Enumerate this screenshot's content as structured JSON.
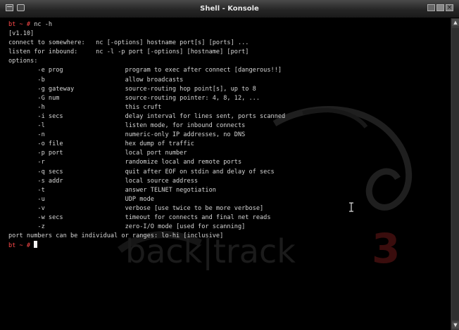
{
  "window": {
    "title": "Shell - Konsole"
  },
  "terminal": {
    "prompt": "bt ~ # ",
    "command": "nc -h",
    "lines": [
      "[v1.10]",
      "connect to somewhere:   nc [-options] hostname port[s] [ports] ...",
      "listen for inbound:     nc -l -p port [-options] [hostname] [port]",
      "options:",
      "        -e prog                 program to exec after connect [dangerous!!]",
      "        -b                      allow broadcasts",
      "        -g gateway              source-routing hop point[s], up to 8",
      "        -G num                  source-routing pointer: 4, 8, 12, ...",
      "        -h                      this cruft",
      "        -i secs                 delay interval for lines sent, ports scanned",
      "        -l                      listen mode, for inbound connects",
      "        -n                      numeric-only IP addresses, no DNS",
      "        -o file                 hex dump of traffic",
      "        -p port                 local port number",
      "        -r                      randomize local and remote ports",
      "        -q secs                 quit after EOF on stdin and delay of secs",
      "        -s addr                 local source address",
      "        -t                      answer TELNET negotiation",
      "        -u                      UDP mode",
      "        -v                      verbose [use twice to be more verbose]",
      "        -w secs                 timeout for connects and final net reads",
      "        -z                      zero-I/O mode [used for scanning]",
      "port numbers can be individual or ranges: lo-hi [inclusive]"
    ],
    "final_prompt": "bt ~ # "
  },
  "wallpaper": {
    "text": "back|track",
    "number": "3"
  },
  "colors": {
    "prompt": "#ff4a4a",
    "text": "#d6d6d6",
    "background": "#000000"
  }
}
